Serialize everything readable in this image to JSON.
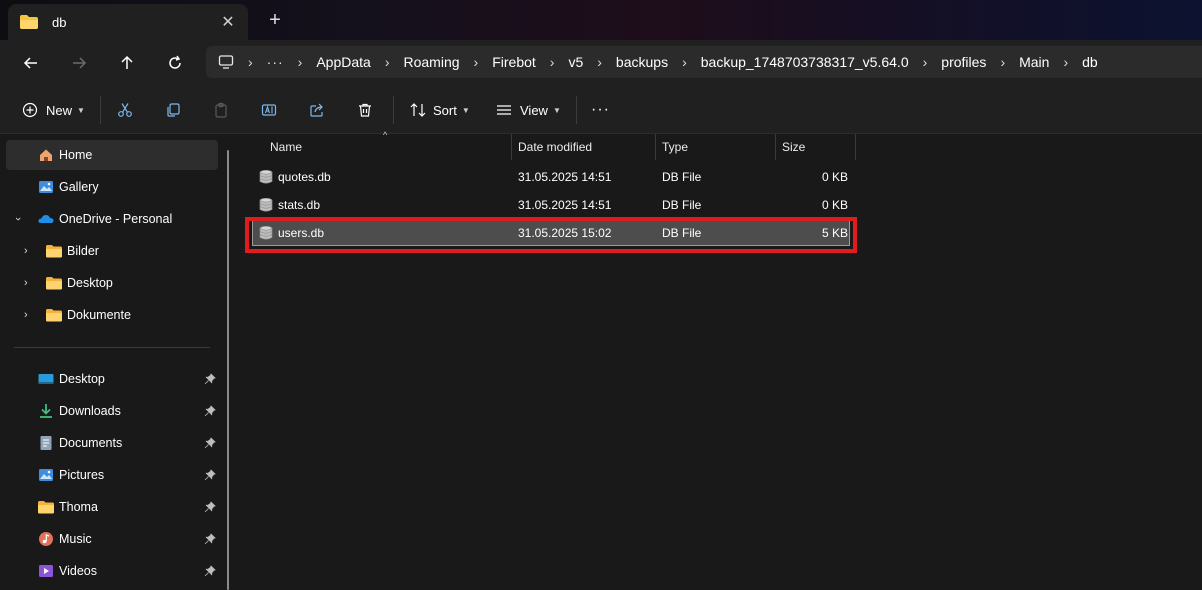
{
  "window": {
    "tab_title": "db",
    "new_tab_symbol": "+",
    "close_symbol": "✕"
  },
  "address": {
    "overflow": "···",
    "crumbs": [
      "AppData",
      "Roaming",
      "Firebot",
      "v5",
      "backups",
      "backup_1748703738317_v5.64.0",
      "profiles",
      "Main",
      "db"
    ]
  },
  "toolbar": {
    "new_label": "New",
    "sort_label": "Sort",
    "view_label": "View",
    "more_label": "···"
  },
  "sidebar": {
    "top_items": [
      {
        "label": "Home",
        "icon": "home-icon"
      },
      {
        "label": "Gallery",
        "icon": "gallery-icon"
      },
      {
        "label": "OneDrive - Personal",
        "icon": "onedrive-icon"
      },
      {
        "label": "Bilder",
        "icon": "folder-icon"
      },
      {
        "label": "Desktop",
        "icon": "folder-icon"
      },
      {
        "label": "Dokumente",
        "icon": "folder-icon"
      }
    ],
    "quick_access": [
      {
        "label": "Desktop",
        "icon": "desktop-icon"
      },
      {
        "label": "Downloads",
        "icon": "downloads-icon"
      },
      {
        "label": "Documents",
        "icon": "documents-icon"
      },
      {
        "label": "Pictures",
        "icon": "pictures-icon"
      },
      {
        "label": "Thoma",
        "icon": "folder-icon"
      },
      {
        "label": "Music",
        "icon": "music-icon"
      },
      {
        "label": "Videos",
        "icon": "videos-icon"
      }
    ]
  },
  "files": {
    "columns": {
      "name": "Name",
      "date": "Date modified",
      "type": "Type",
      "size": "Size"
    },
    "rows": [
      {
        "name": "quotes.db",
        "date": "31.05.2025 14:51",
        "type": "DB File",
        "size": "0 KB",
        "selected": false
      },
      {
        "name": "stats.db",
        "date": "31.05.2025 14:51",
        "type": "DB File",
        "size": "0 KB",
        "selected": false
      },
      {
        "name": "users.db",
        "date": "31.05.2025 15:02",
        "type": "DB File",
        "size": "5 KB",
        "selected": true
      }
    ]
  },
  "colors": {
    "accent": "#0078d4",
    "highlight_border": "#e01c1c",
    "folder": "#f2c14e"
  }
}
